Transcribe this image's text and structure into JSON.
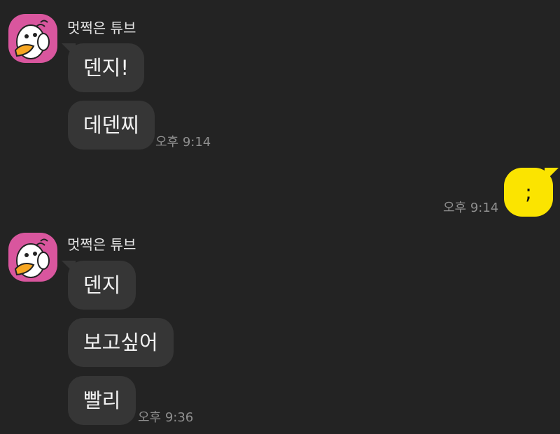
{
  "chat": {
    "groups": [
      {
        "sender": "멋쩍은 튜브",
        "avatar_icon": "tube-duck-avatar",
        "messages": [
          "덴지!",
          "데덴찌"
        ],
        "time": "오후 9:14"
      },
      {
        "mine": true,
        "messages": [
          ";"
        ],
        "time": "오후 9:14"
      },
      {
        "sender": "멋쩍은 튜브",
        "avatar_icon": "tube-duck-avatar",
        "messages": [
          "덴지",
          "보고싶어",
          "빨리"
        ],
        "time": "오후 9:36"
      }
    ]
  },
  "colors": {
    "background": "#232323",
    "incoming_bubble": "#363636",
    "outgoing_bubble": "#fbe400",
    "avatar_background": "#d9569e",
    "timestamp": "#8f8f8f"
  }
}
